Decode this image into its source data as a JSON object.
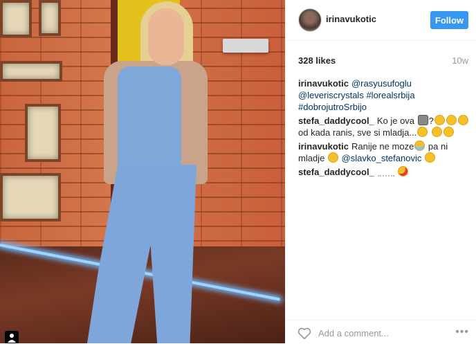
{
  "post": {
    "username": "irinavukotic",
    "follow_label": "Follow",
    "likes": "328 likes",
    "age": "10w"
  },
  "comments": [
    {
      "user": "irinavukotic",
      "parts": [
        {
          "type": "mention",
          "text": "@rasyusufoglu"
        },
        {
          "type": "text",
          "text": " "
        },
        {
          "type": "mention",
          "text": "@leveriscrystals"
        },
        {
          "type": "text",
          "text": " "
        },
        {
          "type": "tag",
          "text": "#lorealsrbija"
        },
        {
          "type": "text",
          "text": " "
        },
        {
          "type": "tag",
          "text": "#dobrojutroSrbijo"
        }
      ]
    },
    {
      "user": "stefa_daddycool_",
      "parts": [
        {
          "type": "text",
          "text": "Ko je ova "
        },
        {
          "type": "emoji",
          "name": "cat-face-emoji"
        },
        {
          "type": "text",
          "text": "?"
        },
        {
          "type": "emoji",
          "name": "smiley-emoji"
        },
        {
          "type": "emoji",
          "name": "smiley-emoji"
        },
        {
          "type": "emoji",
          "name": "smiley-emoji"
        },
        {
          "type": "text",
          "text": " od kada ranis, sve si mladja..."
        },
        {
          "type": "emoji",
          "name": "smiley-emoji"
        },
        {
          "type": "text",
          "text": " "
        },
        {
          "type": "emoji",
          "name": "smiley-emoji"
        },
        {
          "type": "emoji",
          "name": "smiley-emoji"
        }
      ]
    },
    {
      "user": "irinavukotic",
      "parts": [
        {
          "type": "text",
          "text": "Ranije ne moze"
        },
        {
          "type": "emoji",
          "name": "tears-of-joy-emoji"
        },
        {
          "type": "text",
          "text": " pa ni mladje "
        },
        {
          "type": "emoji",
          "name": "smiley-emoji"
        },
        {
          "type": "text",
          "text": " "
        },
        {
          "type": "mention",
          "text": "@slavko_stefanovic"
        },
        {
          "type": "text",
          "text": " "
        },
        {
          "type": "emoji",
          "name": "grin-emoji"
        }
      ]
    },
    {
      "user": "stefa_daddycool_",
      "parts": [
        {
          "type": "emoji",
          "name": "wave-emoji"
        },
        {
          "type": "text",
          "text": " "
        },
        {
          "type": "emoji",
          "name": "kiss-emoji"
        }
      ]
    }
  ],
  "footer": {
    "comment_placeholder": "Add a comment...",
    "more_label": "•••"
  },
  "colors": {
    "follow_button": "#3897f0",
    "mention": "#003569"
  },
  "icons": {
    "like": "heart-icon",
    "more": "more-options-icon",
    "user_tag": "user-tag-icon"
  }
}
